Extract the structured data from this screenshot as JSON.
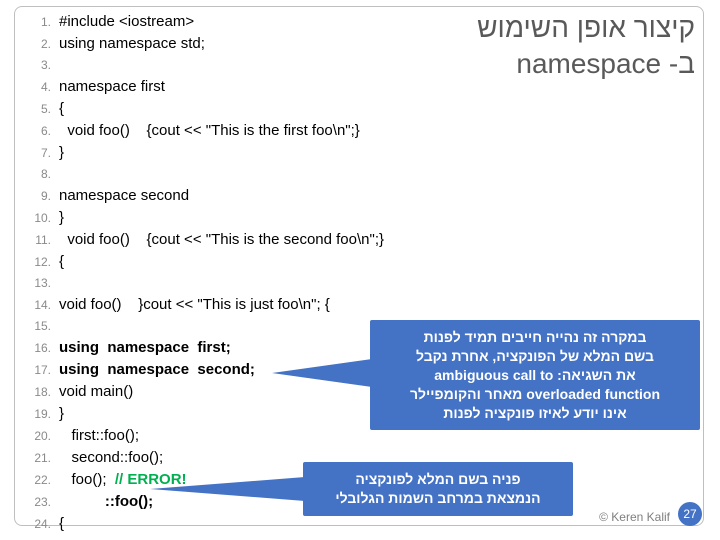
{
  "title_line1": "קיצור אופן השימוש",
  "title_line2": "ב- namespace",
  "code": [
    "#include <iostream>",
    "using namespace std;",
    "",
    "namespace first",
    "{",
    "  void foo()    {cout << \"This is the first foo\\n\";}",
    "}",
    "",
    "namespace second",
    "}",
    "  void foo()    {cout << \"This is the second foo\\n\";}",
    "{",
    "",
    "void foo()    }cout << \"This is just foo\\n\"; {",
    "",
    "using  namespace  first;",
    "using  namespace  second;",
    "void main()",
    "}",
    "   first::foo();",
    "   second::foo();",
    "   foo();  ",
    "           ::foo();",
    "{"
  ],
  "error_comment": "// ERROR!",
  "bold_lines": [
    16,
    17,
    23
  ],
  "callout1": {
    "l1": "במקרה זה נהייה חייבים תמיד לפנות",
    "l2": "בשם המלא של הפונקציה, אחרת נקבל",
    "l3a": "את השגיאה: ",
    "l3b": "ambiguous call to",
    "l4a": "overloaded function",
    "l4b": " מאחר והקומפיילר",
    "l5": "אינו יודע לאיזו פונקציה לפנות"
  },
  "callout2": {
    "l1": "פניה בשם המלא לפונקציה",
    "l2": "הנמצאת במרחב השמות הגלובלי"
  },
  "copyright": "© Keren Kalif",
  "page_number": "27"
}
